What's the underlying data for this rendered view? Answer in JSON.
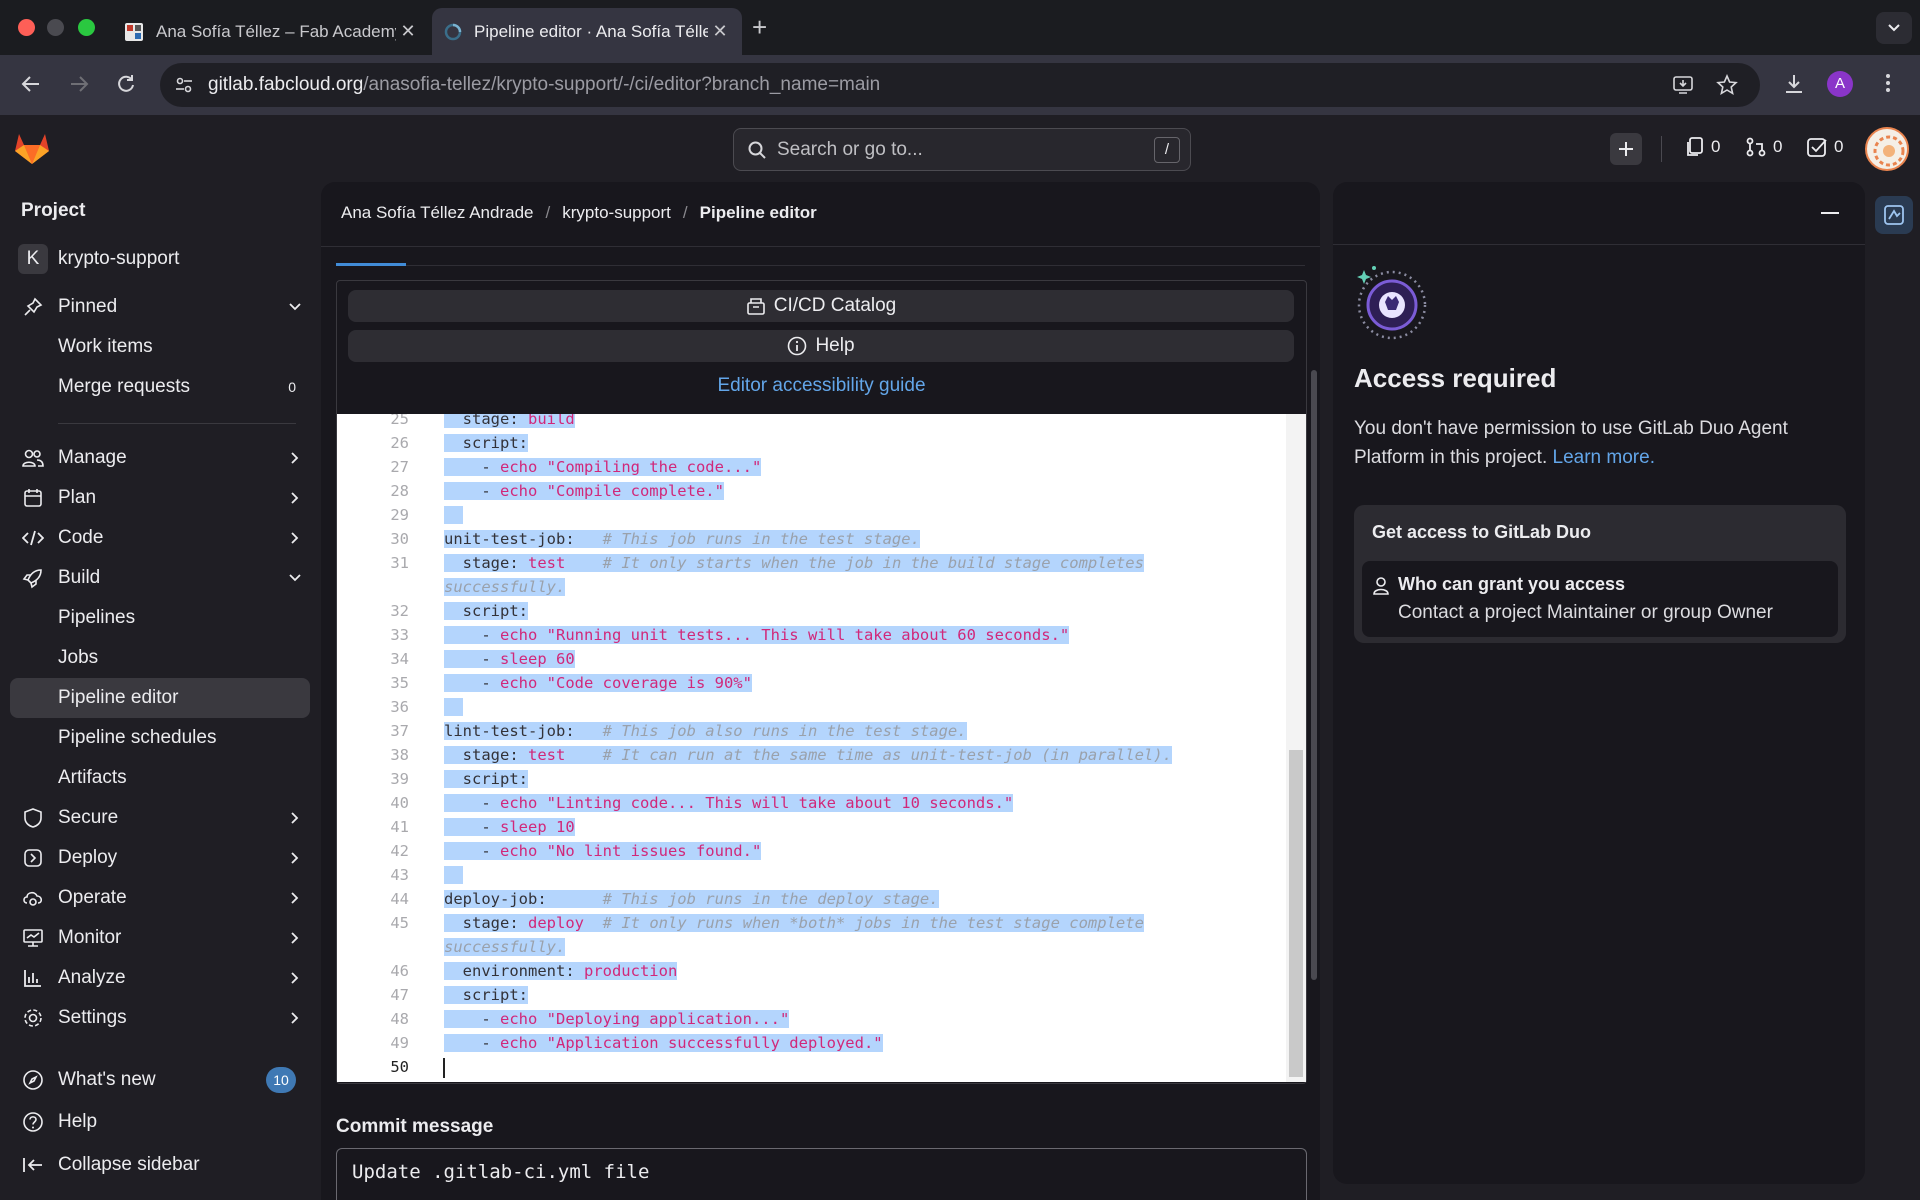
{
  "browser": {
    "tabs": [
      {
        "title": "Ana Sofía Téllez – Fab Academy"
      },
      {
        "title": "Pipeline editor · Ana Sofía Téllez Andrade / krypto-support · GitLab"
      }
    ],
    "url_host": "gitlab.fabcloud.org",
    "url_path": "/anasofia-tellez/krypto-support/-/ci/editor?branch_name=main",
    "profile_initial": "A"
  },
  "topbar": {
    "search_placeholder": "Search or go to...",
    "search_shortcut": "/",
    "issues_count": "0",
    "merge_requests_count": "0",
    "todos_count": "0"
  },
  "sidebar": {
    "heading": "Project",
    "project_initial": "K",
    "project_name": "krypto-support",
    "pinned": "Pinned",
    "pinned_items": [
      {
        "label": "Work items"
      },
      {
        "label": "Merge requests",
        "badge": "0"
      }
    ],
    "sections": [
      {
        "label": "Manage"
      },
      {
        "label": "Plan"
      },
      {
        "label": "Code"
      },
      {
        "label": "Build"
      }
    ],
    "build_items": [
      {
        "label": "Pipelines"
      },
      {
        "label": "Jobs"
      },
      {
        "label": "Pipeline editor"
      },
      {
        "label": "Pipeline schedules"
      },
      {
        "label": "Artifacts"
      }
    ],
    "sections_after": [
      {
        "label": "Secure"
      },
      {
        "label": "Deploy"
      },
      {
        "label": "Operate"
      },
      {
        "label": "Monitor"
      },
      {
        "label": "Analyze"
      },
      {
        "label": "Settings"
      }
    ],
    "whats_new": "What's new",
    "whats_new_badge": "10",
    "help": "Help",
    "collapse": "Collapse sidebar"
  },
  "breadcrumb": {
    "owner": "Ana Sofía Téllez Andrade",
    "separator": "/",
    "project": "krypto-support",
    "current": "Pipeline editor"
  },
  "editor": {
    "catalog_button": "CI/CD Catalog",
    "help_button": "Help",
    "a11y_link": "Editor accessibility guide",
    "lines": [
      {
        "n": "25",
        "parts": [
          [
            "k",
            "  stage: "
          ],
          [
            "s",
            "build"
          ]
        ]
      },
      {
        "n": "26",
        "parts": [
          [
            "k",
            "  script:"
          ]
        ]
      },
      {
        "n": "27",
        "parts": [
          [
            "k",
            "    - "
          ],
          [
            "s",
            "echo \"Compiling the code...\""
          ]
        ]
      },
      {
        "n": "28",
        "parts": [
          [
            "k",
            "    - "
          ],
          [
            "s",
            "echo \"Compile complete.\""
          ]
        ]
      },
      {
        "n": "29",
        "parts": [
          [
            "k",
            "  "
          ]
        ]
      },
      {
        "n": "30",
        "parts": [
          [
            "k",
            "unit-test-job:   "
          ],
          [
            "c",
            "# This job runs in the test stage."
          ]
        ]
      },
      {
        "n": "31",
        "parts": [
          [
            "k",
            "  stage: "
          ],
          [
            "s",
            "test"
          ],
          [
            "k",
            "    "
          ],
          [
            "c",
            "# It only starts when the job in the build stage completes"
          ]
        ]
      },
      {
        "n": "",
        "parts": [
          [
            "c",
            "successfully."
          ]
        ]
      },
      {
        "n": "32",
        "parts": [
          [
            "k",
            "  script:"
          ]
        ]
      },
      {
        "n": "33",
        "parts": [
          [
            "k",
            "    - "
          ],
          [
            "s",
            "echo \"Running unit tests... This will take about 60 seconds.\""
          ]
        ]
      },
      {
        "n": "34",
        "parts": [
          [
            "k",
            "    - "
          ],
          [
            "s",
            "sleep 60"
          ]
        ]
      },
      {
        "n": "35",
        "parts": [
          [
            "k",
            "    - "
          ],
          [
            "s",
            "echo \"Code coverage is 90%\""
          ]
        ]
      },
      {
        "n": "36",
        "parts": [
          [
            "k",
            "  "
          ]
        ]
      },
      {
        "n": "37",
        "parts": [
          [
            "k",
            "lint-test-job:   "
          ],
          [
            "c",
            "# This job also runs in the test stage."
          ]
        ]
      },
      {
        "n": "38",
        "parts": [
          [
            "k",
            "  stage: "
          ],
          [
            "s",
            "test"
          ],
          [
            "k",
            "    "
          ],
          [
            "c",
            "# It can run at the same time as unit-test-job (in parallel)."
          ]
        ]
      },
      {
        "n": "39",
        "parts": [
          [
            "k",
            "  script:"
          ]
        ]
      },
      {
        "n": "40",
        "parts": [
          [
            "k",
            "    - "
          ],
          [
            "s",
            "echo \"Linting code... This will take about 10 seconds.\""
          ]
        ]
      },
      {
        "n": "41",
        "parts": [
          [
            "k",
            "    - "
          ],
          [
            "s",
            "sleep 10"
          ]
        ]
      },
      {
        "n": "42",
        "parts": [
          [
            "k",
            "    - "
          ],
          [
            "s",
            "echo \"No lint issues found.\""
          ]
        ]
      },
      {
        "n": "43",
        "parts": [
          [
            "k",
            "  "
          ]
        ]
      },
      {
        "n": "44",
        "parts": [
          [
            "k",
            "deploy-job:      "
          ],
          [
            "c",
            "# This job runs in the deploy stage."
          ]
        ]
      },
      {
        "n": "45",
        "parts": [
          [
            "k",
            "  stage: "
          ],
          [
            "s",
            "deploy"
          ],
          [
            "k",
            "  "
          ],
          [
            "c",
            "# It only runs when *both* jobs in the test stage complete"
          ]
        ]
      },
      {
        "n": "",
        "parts": [
          [
            "c",
            "successfully."
          ]
        ]
      },
      {
        "n": "46",
        "parts": [
          [
            "k",
            "  environment: "
          ],
          [
            "s",
            "production"
          ]
        ]
      },
      {
        "n": "47",
        "parts": [
          [
            "k",
            "  script:"
          ]
        ]
      },
      {
        "n": "48",
        "parts": [
          [
            "k",
            "    - "
          ],
          [
            "s",
            "echo \"Deploying application...\""
          ]
        ]
      },
      {
        "n": "49",
        "parts": [
          [
            "k",
            "    - "
          ],
          [
            "s",
            "echo \"Application successfully deployed.\""
          ]
        ]
      },
      {
        "n": "50",
        "parts": [],
        "current": true
      }
    ]
  },
  "commit": {
    "label": "Commit message",
    "value": "Update .gitlab-ci.yml file"
  },
  "duo": {
    "title": "Access required",
    "description": "You don't have permission to use GitLab Duo Agent Platform in this project.",
    "learn_more": "Learn more.",
    "card_title": "Get access to GitLab Duo",
    "who_title": "Who can grant you access",
    "who_desc": "Contact a project Maintainer or group Owner"
  },
  "colors": {
    "accent": "#63a6e9",
    "string": "#d1287a",
    "selection": "#b4d5fd",
    "sidebar_active": "#3a393f"
  }
}
